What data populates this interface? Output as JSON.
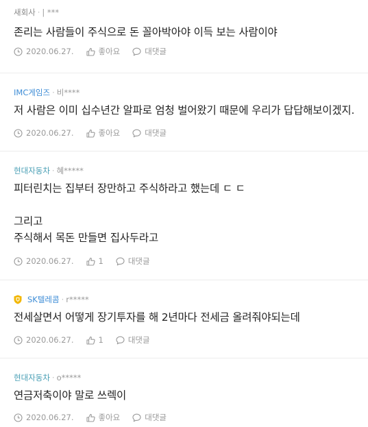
{
  "comments": [
    {
      "company": "새회사",
      "sep": "·",
      "nick": "| ***",
      "text": "존리는 사람들이 주식으로 돈 꼴아박아야 이득 보는 사람이야",
      "date": "2020.06.27.",
      "like": "좋아요",
      "reply": "대댓글"
    },
    {
      "company": "IMC게임즈",
      "sep": "·",
      "nick": "비****",
      "text": "저 사람은 이미 십수년간 알파로 엄청 벌어왔기 때문에 우리가 답답해보이겠지.",
      "date": "2020.06.27.",
      "like": "좋아요",
      "reply": "대댓글"
    },
    {
      "company": "현대자동차",
      "sep": "·",
      "nick": "혜*****",
      "text": "피터린치는 집부터 장만하고 주식하라고 했는데 ㄷ ㄷ\n\n그리고\n주식해서 목돈 만들면 집사두라고",
      "date": "2020.06.27.",
      "like": "1",
      "reply": "대댓글"
    },
    {
      "company": "SK텔레콤",
      "sep": "·",
      "nick": "r*****",
      "text": "전세살면서 어떻게 장기투자를 해 2년마다 전세금 올려줘야되는데",
      "date": "2020.06.27.",
      "like": "1",
      "reply": "대댓글"
    },
    {
      "company": "현대자동차",
      "sep": "·",
      "nick": "o*****",
      "text": "연금저축이야 말로 쓰렉이",
      "date": "2020.06.27.",
      "like": "좋아요",
      "reply": "대댓글"
    }
  ],
  "colors": {
    "company_blue": "#3d8cd6",
    "company_teal": "#4a9fb5",
    "meta": "#999999",
    "badge": "#f2b705"
  },
  "icons": {
    "date": "clock-icon",
    "like": "thumbs-up-icon",
    "reply": "speech-bubble-icon",
    "badge": "shield-badge-icon"
  }
}
